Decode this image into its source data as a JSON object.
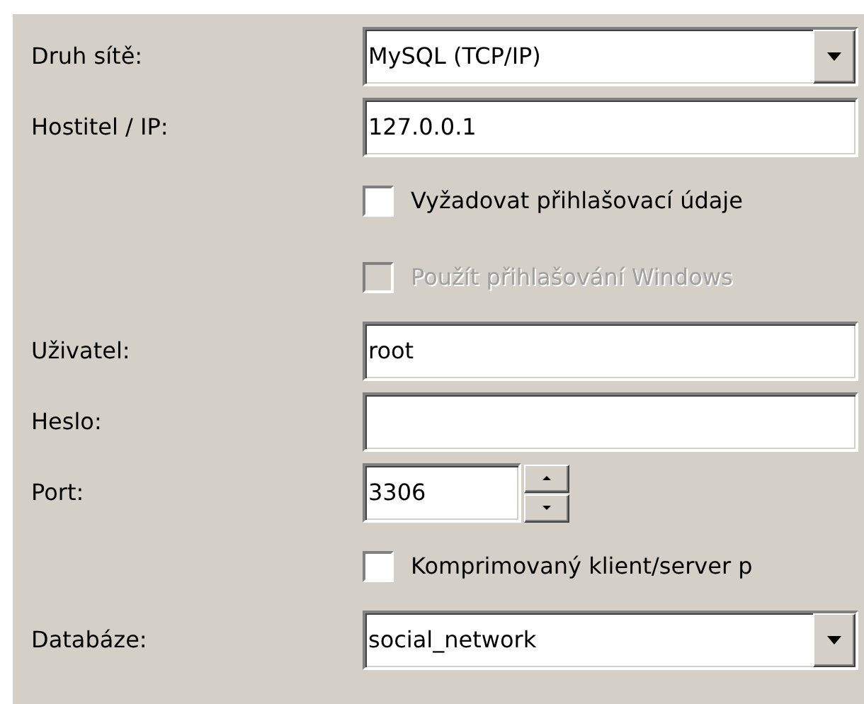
{
  "fields": [
    {
      "kind": "select",
      "label": "Druh sítě:",
      "value": "MySQL (TCP/IP)"
    },
    {
      "kind": "text",
      "label": "Hostitel / IP:",
      "value": "127.0.0.1"
    },
    {
      "kind": "checkbox",
      "text": "Vyžadovat přihlašovací údaje",
      "checked": false,
      "disabled": false
    },
    {
      "kind": "checkbox",
      "text": "Použít přihlašování Windows",
      "checked": false,
      "disabled": true
    },
    {
      "kind": "text",
      "label": "Uživatel:",
      "value": "root"
    },
    {
      "kind": "text",
      "label": "Heslo:"
    },
    {
      "kind": "spinner",
      "label": "Port:",
      "value": "3306"
    },
    {
      "kind": "checkbox",
      "text": "Komprimovaný klient/server p",
      "checked": false,
      "disabled": false
    },
    {
      "kind": "select",
      "label": "Databáze:",
      "value": "social_network"
    }
  ]
}
